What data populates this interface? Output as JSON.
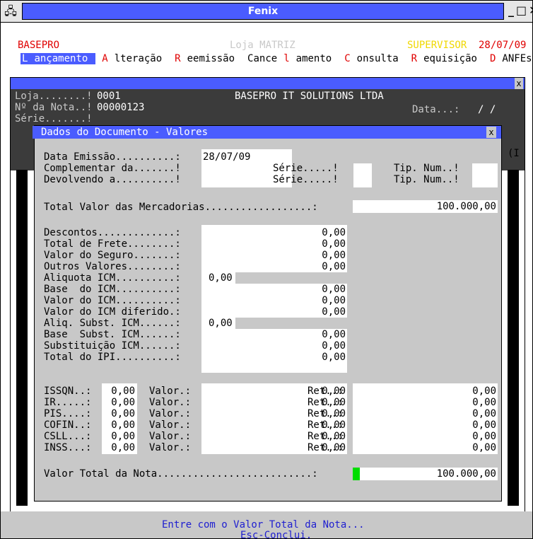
{
  "window": {
    "title": "Fenix",
    "controls": [
      "_",
      "□",
      "✕"
    ]
  },
  "header": {
    "company": "BASEPRO",
    "store": "Loja MATRIZ",
    "user": "SUPERVISOR",
    "date": "28/07/09"
  },
  "menu": {
    "items": [
      {
        "label": "Lançamento",
        "hotkey": "L",
        "rest": "ançamento",
        "active": true
      },
      {
        "label": "Alteração",
        "hotkey": "A",
        "rest": "lteração"
      },
      {
        "label": "Reemissão",
        "hotkey": "R",
        "rest": "eemissão"
      },
      {
        "label": "Cancelamento",
        "pre": "Cance",
        "hotkey": "l",
        "rest": "amento"
      },
      {
        "label": "Consulta",
        "hotkey": "C",
        "rest": "onsulta"
      },
      {
        "label": "Requisição",
        "hotkey": "R",
        "rest": "equisição"
      },
      {
        "label": "DANFEs",
        "hotkey": "D",
        "rest": "ANFEs"
      }
    ]
  },
  "background_form": {
    "loja_label": "Loja........!",
    "loja_value": "0001",
    "company_name": "BASEPRO IT SOLUTIONS LTDA",
    "nota_label": "Nº da Nota..!",
    "nota_value": "00000123",
    "data_label": "Data...:",
    "data_value": "/ /",
    "serie_label": "Série.......!",
    "partial_right": "(I"
  },
  "dialog": {
    "title": "Dados do Documento - Valores",
    "close": "x",
    "data_emissao_label": "Data Emissão..........:",
    "data_emissao_value": "28/07/09",
    "complementar_label": "Complementar da.......!",
    "devolvendo_label": "Devolvendo a..........!",
    "serie_label": "Série.....!",
    "tipnum_label": "Tip. Num..!",
    "total_mercadorias_label": "Total Valor das Mercadorias..................:",
    "total_mercadorias_value": "100.000,00",
    "values": [
      {
        "label": "Descontos.............:",
        "value": "0,00"
      },
      {
        "label": "Total de Frete........:",
        "value": "0,00"
      },
      {
        "label": "Valor do Seguro.......:",
        "value": "0,00"
      },
      {
        "label": "Outros Valores........:",
        "value": "0,00"
      },
      {
        "label": "Aliquota ICM..........:",
        "value": "0,00",
        "small": true
      },
      {
        "label": "Base  do ICM..........:",
        "value": "0,00"
      },
      {
        "label": "Valor do ICM..........:",
        "value": "0,00"
      },
      {
        "label": "Valor do ICM diferido.:",
        "value": "0,00"
      },
      {
        "label": "Aliq. Subst. ICM......:",
        "value": "0,00",
        "small": true
      },
      {
        "label": "Base  Subst. ICM......:",
        "value": "0,00"
      },
      {
        "label": "Substituição ICM......:",
        "value": "0,00"
      },
      {
        "label": "Total do IPI..........:",
        "value": "0,00"
      }
    ],
    "taxes": [
      {
        "label": "ISSQN..:",
        "rate": "0,00",
        "valor_label": "Valor.:",
        "valor": "0,00",
        "ret_label": "Ret..:",
        "ret": "0,00"
      },
      {
        "label": "IR.....:",
        "rate": "0,00",
        "valor_label": "Valor.:",
        "valor": "0,00",
        "ret_label": "Ret..:",
        "ret": "0,00"
      },
      {
        "label": "PIS....:",
        "rate": "0,00",
        "valor_label": "Valor.:",
        "valor": "0,00",
        "ret_label": "Ret..:",
        "ret": "0,00"
      },
      {
        "label": "COFIN..:",
        "rate": "0,00",
        "valor_label": "Valor.:",
        "valor": "0,00",
        "ret_label": "Ret..:",
        "ret": "0,00"
      },
      {
        "label": "CSLL...:",
        "rate": "0,00",
        "valor_label": "Valor.:",
        "valor": "0,00",
        "ret_label": "Ret..:",
        "ret": "0,00"
      },
      {
        "label": "INSS...:",
        "rate": "0,00",
        "valor_label": "Valor.:",
        "valor": "0,00",
        "ret_label": "Ret..:",
        "ret": "0,00"
      }
    ],
    "valor_total_label": "Valor Total da Nota..........................:",
    "valor_total_value": "100.000,00"
  },
  "status": {
    "line1": "Entre com o Valor Total da Nota...",
    "line2": "Esc-Conclui."
  },
  "colors": {
    "accent_blue": "#4a5cff",
    "panel_gray": "#c8c8c8",
    "hotkey_red": "#e00000",
    "cursor_green": "#00dd00",
    "user_yellow": "#f0d800"
  }
}
